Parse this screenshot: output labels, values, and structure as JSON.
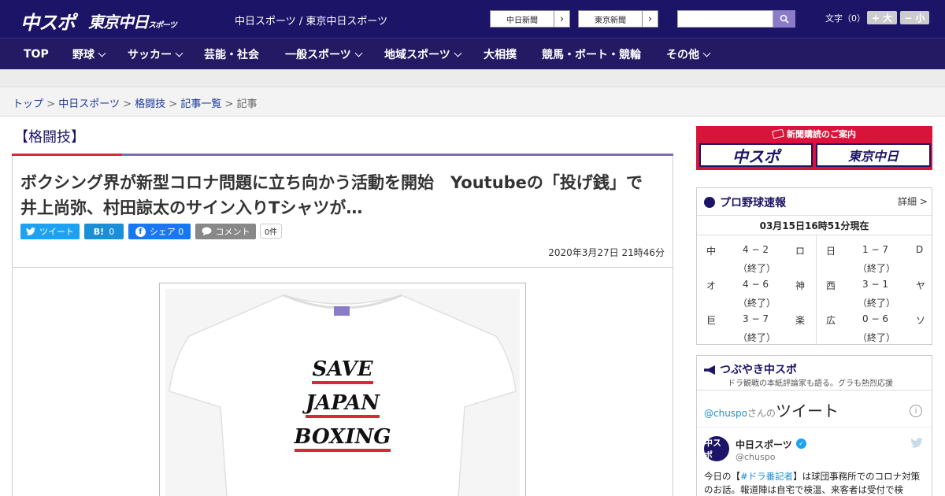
{
  "header": {
    "logo_primary": "中スポ",
    "logo_secondary": "東京中日",
    "logo_secondary_small": "スポーツ",
    "tagline": "中日スポーツ / 東京中日スポーツ",
    "link_chunichi": "中日新聞",
    "link_tokyo": "東京新聞",
    "arrow": "›",
    "search_icon": "search-icon",
    "font_size_label": "文字（0）",
    "font_plus": "+ 大",
    "font_minus": "− 小"
  },
  "nav": {
    "items": [
      {
        "label": "TOP",
        "dropdown": false
      },
      {
        "label": "野球",
        "dropdown": true
      },
      {
        "label": "サッカー",
        "dropdown": true
      },
      {
        "label": "芸能・社会",
        "dropdown": false
      },
      {
        "label": "一般スポーツ",
        "dropdown": true
      },
      {
        "label": "地域スポーツ",
        "dropdown": true
      },
      {
        "label": "大相撲",
        "dropdown": false
      },
      {
        "label": "競馬・ボート・競輪",
        "dropdown": false
      },
      {
        "label": "その他",
        "dropdown": true
      }
    ]
  },
  "breadcrumb": {
    "items": [
      "トップ",
      "中日スポーツ",
      "格闘技",
      "記事一覧"
    ],
    "current": "記事",
    "separator": ">"
  },
  "article": {
    "category": "【格闘技】",
    "title_line1": "ボクシング界が新型コロナ問題に立ち向かう活動を開始　Youtubeの「投げ銭」で",
    "title_line2": "井上尚弥、村田諒太のサイン入りTシャツが…",
    "share": {
      "tweet": "ツイート",
      "hatena": "0",
      "facebook": "シェア 0",
      "comment": "コメント",
      "comment_count": "0件"
    },
    "date": "2020年3月27日 21時46分",
    "image_text": [
      "SAVE",
      "JAPAN",
      "BOXING"
    ]
  },
  "sidebar": {
    "subscribe_header": "新聞購読のご案内",
    "subscribe_left": "中スポ",
    "subscribe_right": "東京中日",
    "baseball": {
      "title": "プロ野球速報",
      "more": "詳細 >",
      "time": "03月15日16時51分現在",
      "games": [
        {
          "home": "中",
          "score": "4 − 2",
          "away": "ロ",
          "status": "（終了）"
        },
        {
          "home": "日",
          "score": "1 − 7",
          "away": "D",
          "status": "（終了）"
        },
        {
          "home": "オ",
          "score": "4 − 6",
          "away": "神",
          "status": "（終了）"
        },
        {
          "home": "西",
          "score": "3 − 1",
          "away": "ヤ",
          "status": "（終了）"
        },
        {
          "home": "巨",
          "score": "3 − 7",
          "away": "楽",
          "status": "（終了）"
        },
        {
          "home": "広",
          "score": "0 − 6",
          "away": "ソ",
          "status": "（終了）"
        }
      ]
    },
    "tweets": {
      "title": "つぶやき中スポ",
      "subtitle": "ドラ観戦の本紙評論家も語る。グラも熱烈応援",
      "head_handle": "@chuspo",
      "head_san": "さんの",
      "head_tweet": "ツイート",
      "account_name": "中日スポーツ",
      "account_handle": "@chuspo",
      "avatar_text": "中スポ",
      "text_pre": "今日の【",
      "text_tag": "#ドラ番記者",
      "text_post": "】は球団事務所でのコロナ対策のお話。報道陣は自宅で検温、来客者は受付で検"
    }
  }
}
